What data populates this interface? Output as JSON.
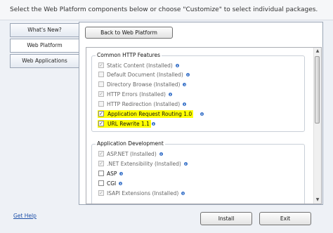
{
  "header": {
    "instructions": "Select the Web Platform components below or choose \"Customize\" to select individual packages."
  },
  "tabs": [
    {
      "label": "What's New?",
      "active": false
    },
    {
      "label": "Web Platform",
      "active": true
    },
    {
      "label": "Web Applications",
      "active": false
    }
  ],
  "content": {
    "back_button": "Back to Web Platform",
    "groups": [
      {
        "title": "Common HTTP Features",
        "items": [
          {
            "label": "Static Content  (Installed)",
            "checked": true,
            "enabled": false,
            "highlighted": false
          },
          {
            "label": "Default Document  (Installed)",
            "checked": false,
            "enabled": false,
            "highlighted": false
          },
          {
            "label": "Directory Browse  (Installed)",
            "checked": false,
            "enabled": false,
            "highlighted": false
          },
          {
            "label": "HTTP Errors  (Installed)",
            "checked": true,
            "enabled": false,
            "highlighted": false
          },
          {
            "label": "HTTP Redirection  (Installed)",
            "checked": false,
            "enabled": false,
            "highlighted": false
          },
          {
            "label": "Application Request Routing 1.0",
            "checked": true,
            "enabled": true,
            "highlighted": true
          },
          {
            "label": "URL Rewrite 1.1",
            "checked": true,
            "enabled": true,
            "highlighted": true
          }
        ]
      },
      {
        "title": "Application Development",
        "items": [
          {
            "label": "ASP.NET  (Installed)",
            "checked": true,
            "enabled": false,
            "highlighted": false
          },
          {
            "label": ".NET Extensibility  (Installed)",
            "checked": true,
            "enabled": false,
            "highlighted": false
          },
          {
            "label": "ASP",
            "checked": false,
            "enabled": true,
            "highlighted": false
          },
          {
            "label": "CGI",
            "checked": false,
            "enabled": true,
            "highlighted": false
          },
          {
            "label": "ISAPI Extensions  (Installed)",
            "checked": true,
            "enabled": false,
            "highlighted": false
          }
        ]
      }
    ]
  },
  "footer": {
    "help_link": "Get Help",
    "install_button": "Install",
    "exit_button": "Exit"
  },
  "icons": {
    "info": "info-icon",
    "check": "checkmark-icon"
  },
  "colors": {
    "highlight": "#ffff00",
    "link": "#1c4fa8",
    "info_icon": "#3a73c9"
  }
}
